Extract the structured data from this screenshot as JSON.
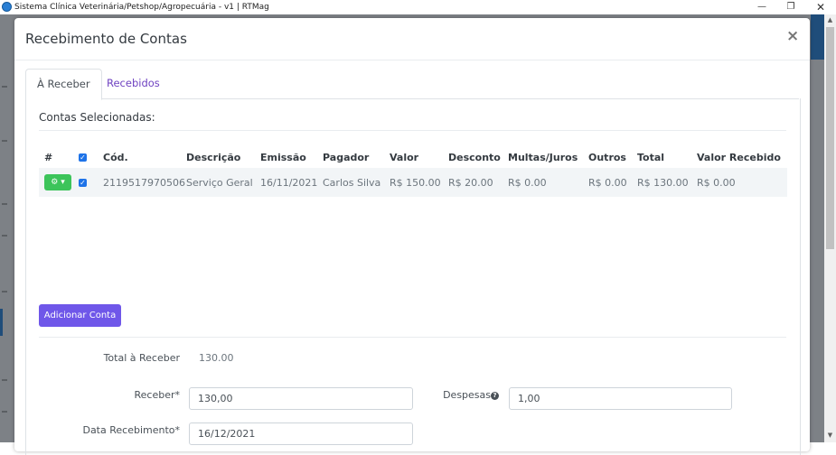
{
  "window": {
    "title": "Sistema Clínica Veterinária/Petshop/Agropecuária - v1 | RTMag",
    "minimize": "—",
    "maximize": "❐",
    "close": "✕"
  },
  "modal": {
    "title": "Recebimento de Contas",
    "close": "×"
  },
  "tabs": [
    {
      "label": "À Receber",
      "active": true
    },
    {
      "label": "Recebidos",
      "active": false
    }
  ],
  "section_title": "Contas Selecionadas:",
  "table": {
    "headers": [
      "#",
      "",
      "Cód.",
      "Descrição",
      "Emissão",
      "Pagador",
      "Valor",
      "Desconto",
      "Multas/Juros",
      "Outros",
      "Total",
      "Valor Recebido"
    ],
    "rows": [
      {
        "code": "2119517970506",
        "description": "Serviço Geral",
        "emission": "16/11/2021",
        "payer": "Carlos Silva",
        "value": "R$ 150.00",
        "discount": "R$ 20.00",
        "fines": "R$ 0.00",
        "others": "R$ 0.00",
        "total": "R$ 130.00",
        "received": "R$ 0.00"
      }
    ]
  },
  "add_button": "Adicionar Conta",
  "form": {
    "total_label": "Total à Receber",
    "total_value": "130.00",
    "receive_label": "Receber*",
    "receive_value": "130,00",
    "expenses_label": "Despesas",
    "expenses_value": "1,00",
    "date_label": "Data Recebimento*",
    "date_value": "16/12/2021"
  },
  "colors": {
    "accent": "#6f57e9",
    "checkbox": "#1e73e8",
    "gear_button": "#3cc45a",
    "tab_link": "#6f42c1"
  }
}
